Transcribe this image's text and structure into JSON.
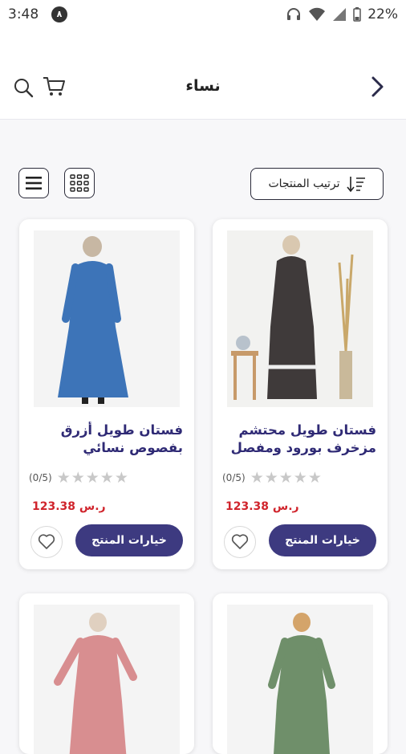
{
  "status_bar": {
    "time": "3:48",
    "notification_badge": "٨",
    "battery": "22%"
  },
  "app_bar": {
    "title": "نساء"
  },
  "toolbar": {
    "sort_label": "ترتيب المنتجات"
  },
  "products": [
    {
      "name": "فستان طويل محتشم مزخرف بورود ومفصل ...",
      "rating_count": "(0/5)",
      "price": "123.38 ر.س",
      "options_label": "خيارات المنتج",
      "dress_color": "#3f3a3a"
    },
    {
      "name": "فستان طويل أزرق بفصوص نسائي",
      "rating_count": "(0/5)",
      "price": "123.38 ر.س",
      "options_label": "خيارات المنتج",
      "dress_color": "#3d74b8"
    },
    {
      "name": "",
      "dress_color": "#6f8f6a"
    },
    {
      "name": "",
      "dress_color": "#d88e90"
    }
  ],
  "colors": {
    "accent": "#3d3a80",
    "title_text": "#2f2a75",
    "price": "#d0242c"
  }
}
